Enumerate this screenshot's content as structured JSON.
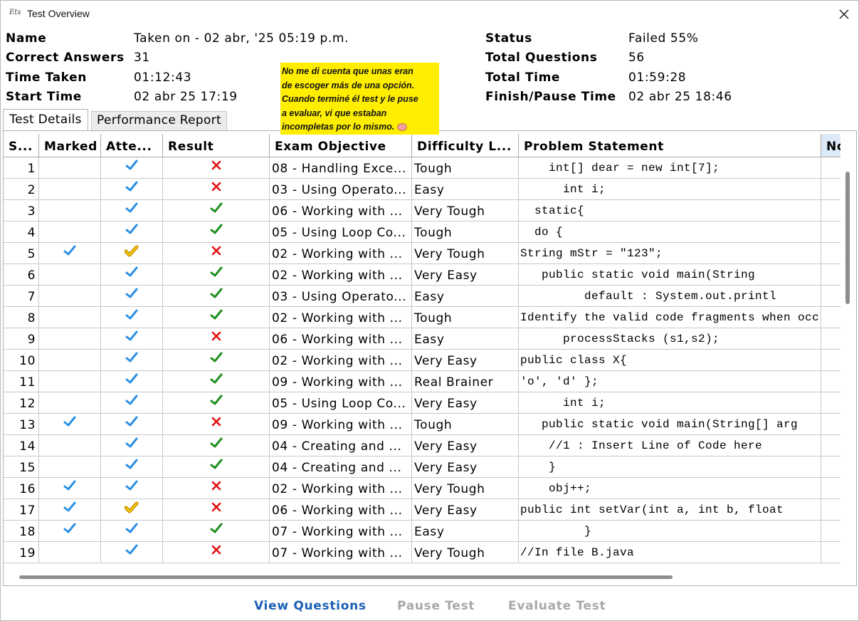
{
  "window": {
    "title": "Test Overview",
    "app_icon_text": "Ets"
  },
  "info": {
    "name_label": "Name",
    "name_value": "Taken on - 02 abr, '25 05:19 p.m.",
    "correct_label": "Correct Answers",
    "correct_value": "31",
    "time_taken_label": "Time Taken",
    "time_taken_value": "01:12:43",
    "start_label": "Start Time",
    "start_value": "02 abr 25 17:19",
    "status_label": "Status",
    "status_value": "Failed 55%",
    "total_q_label": "Total Questions",
    "total_q_value": "56",
    "total_time_label": "Total Time",
    "total_time_value": "01:59:28",
    "finish_label": "Finish/Pause Time",
    "finish_value": "02 abr 25 18:46"
  },
  "sticky_note": {
    "line1": "No me di cuenta que unas eran",
    "line2": "de escoger más de una opción.",
    "line3": "Cuando terminé él test y le puse",
    "line4": "a evaluar, vi que estaban",
    "line5": "incompletas por lo mismo."
  },
  "tabs": {
    "details": "Test Details",
    "performance": "Performance Report"
  },
  "columns": {
    "seq": "S...",
    "marked": "Marked",
    "attempted": "Atte...",
    "result": "Result",
    "objective": "Exam Objective",
    "difficulty": "Difficulty L...",
    "problem": "Problem Statement",
    "notes": "No"
  },
  "colors": {
    "check_blue": "#2b8fe6",
    "check_green": "#1f8f1f",
    "cross_red": "#e01010",
    "partial_yellow": "#f5c400",
    "link_blue": "#1a5fb4"
  },
  "rows": [
    {
      "n": "1",
      "marked": false,
      "att": "full",
      "res": "wrong",
      "obj": "08 - Handling Exce...",
      "diff": "Tough",
      "prob": "    int[] dear = new int[7];"
    },
    {
      "n": "2",
      "marked": false,
      "att": "full",
      "res": "wrong",
      "obj": "03 - Using Operato...",
      "diff": "Easy",
      "prob": "      int i;"
    },
    {
      "n": "3",
      "marked": false,
      "att": "full",
      "res": "right",
      "obj": "06 - Working with ...",
      "diff": "Very Tough",
      "prob": "  static{"
    },
    {
      "n": "4",
      "marked": false,
      "att": "full",
      "res": "right",
      "obj": "05 - Using Loop Co...",
      "diff": "Tough",
      "prob": "  do {"
    },
    {
      "n": "5",
      "marked": true,
      "att": "partial",
      "res": "wrong",
      "obj": "02 - Working with ...",
      "diff": "Very Tough",
      "prob": "String mStr = \"123\";"
    },
    {
      "n": "6",
      "marked": false,
      "att": "full",
      "res": "right",
      "obj": "02 - Working with ...",
      "diff": "Very Easy",
      "prob": "   public static void main(String"
    },
    {
      "n": "7",
      "marked": false,
      "att": "full",
      "res": "right",
      "obj": "03 - Using Operato...",
      "diff": "Easy",
      "prob": "         default : System.out.printl"
    },
    {
      "n": "8",
      "marked": false,
      "att": "full",
      "res": "right",
      "obj": "02 - Working with ...",
      "diff": "Tough",
      "prob": "Identify the valid code fragments when occ..."
    },
    {
      "n": "9",
      "marked": false,
      "att": "full",
      "res": "wrong",
      "obj": "06 - Working with ...",
      "diff": "Easy",
      "prob": "      processStacks (s1,s2);"
    },
    {
      "n": "10",
      "marked": false,
      "att": "full",
      "res": "right",
      "obj": "02 - Working with ...",
      "diff": "Very Easy",
      "prob": "public class X{"
    },
    {
      "n": "11",
      "marked": false,
      "att": "full",
      "res": "right",
      "obj": "09 - Working with ...",
      "diff": "Real Brainer",
      "prob": "'o', 'd' };"
    },
    {
      "n": "12",
      "marked": false,
      "att": "full",
      "res": "right",
      "obj": "05 - Using Loop Co...",
      "diff": "Very Easy",
      "prob": "      int i;"
    },
    {
      "n": "13",
      "marked": true,
      "att": "full",
      "res": "wrong",
      "obj": "09 - Working with ...",
      "diff": "Tough",
      "prob": "   public static void main(String[] arg"
    },
    {
      "n": "14",
      "marked": false,
      "att": "full",
      "res": "right",
      "obj": "04 - Creating and ...",
      "diff": "Very Easy",
      "prob": "    //1 : Insert Line of Code here"
    },
    {
      "n": "15",
      "marked": false,
      "att": "full",
      "res": "right",
      "obj": "04 - Creating and ...",
      "diff": "Very Easy",
      "prob": "    }"
    },
    {
      "n": "16",
      "marked": true,
      "att": "full",
      "res": "wrong",
      "obj": "02 - Working with ...",
      "diff": "Very Tough",
      "prob": "    obj++;"
    },
    {
      "n": "17",
      "marked": true,
      "att": "partial",
      "res": "wrong",
      "obj": "06 - Working with ...",
      "diff": "Very Easy",
      "prob": "public int setVar(int a, int b, float"
    },
    {
      "n": "18",
      "marked": true,
      "att": "full",
      "res": "right",
      "obj": "07 - Working with ...",
      "diff": "Easy",
      "prob": "         }"
    },
    {
      "n": "19",
      "marked": false,
      "att": "full",
      "res": "wrong",
      "obj": "07 - Working with ...",
      "diff": "Very Tough",
      "prob": "//In file B.java"
    }
  ],
  "buttons": {
    "view": "View Questions",
    "pause": "Pause Test",
    "evaluate": "Evaluate Test"
  }
}
